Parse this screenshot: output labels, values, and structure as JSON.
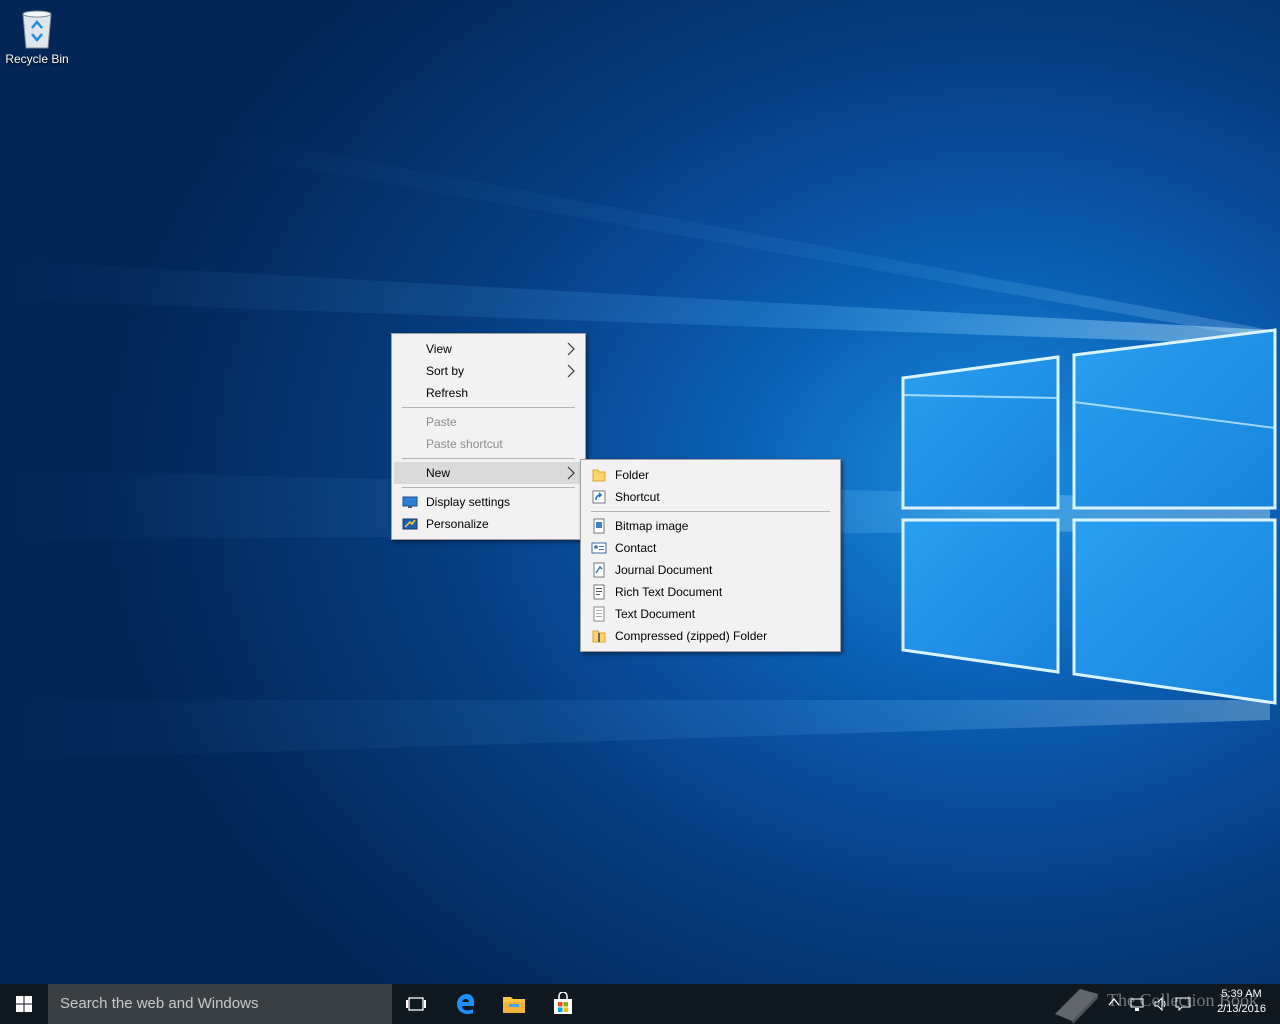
{
  "desktop": {
    "icons": [
      {
        "label": "Recycle Bin",
        "icon": "recycle-bin-icon"
      }
    ]
  },
  "context_menu": {
    "items": {
      "view": "View",
      "sort_by": "Sort by",
      "refresh": "Refresh",
      "paste": "Paste",
      "paste_shortcut": "Paste shortcut",
      "new": "New",
      "display_settings": "Display settings",
      "personalize": "Personalize"
    },
    "disabled": [
      "Paste",
      "Paste shortcut"
    ],
    "highlighted": "New"
  },
  "new_submenu": {
    "items": {
      "folder": "Folder",
      "shortcut": "Shortcut",
      "bitmap": "Bitmap image",
      "contact": "Contact",
      "journal": "Journal Document",
      "rtf": "Rich Text Document",
      "text": "Text Document",
      "zip": "Compressed (zipped) Folder"
    }
  },
  "taskbar": {
    "search_placeholder": "Search the web and Windows",
    "pinned": [
      "task-view-icon",
      "edge-icon",
      "file-explorer-icon",
      "store-icon"
    ],
    "clock_time": "5:39 AM",
    "clock_date": "2/13/2016",
    "watermark": "The Collection Book"
  },
  "colors": {
    "accent": "#0078d7",
    "taskbar": "#101820",
    "menu_bg": "#f2f2f2",
    "menu_highlight": "#dadada"
  }
}
